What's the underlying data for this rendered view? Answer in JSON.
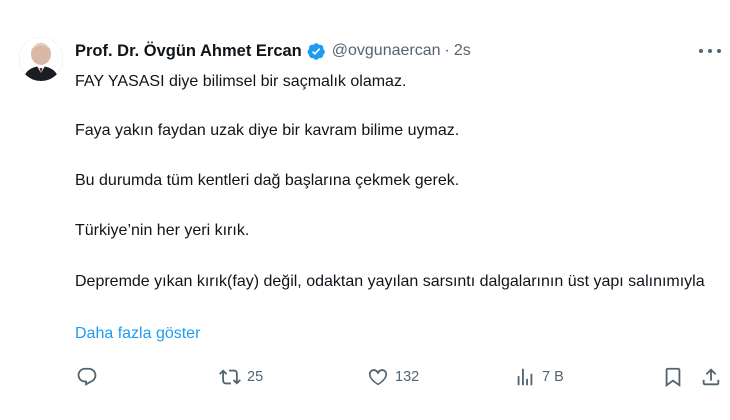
{
  "author": {
    "name": "Prof. Dr. Övgün Ahmet Ercan",
    "handle": "@ovgunaercan",
    "separator": "·",
    "time": "2s",
    "verified": true,
    "verified_color": "#1d9bf0"
  },
  "tweet": {
    "paragraphs": [
      "FAY YASASI diye bilimsel bir saçmalık olamaz.",
      "Faya yakın faydan uzak diye bir kavram bilime uymaz.",
      "Bu durumda tüm kentleri dağ başlarına çekmek gerek.",
      "Türkiye’nin her yeri kırık.",
      "Depremde yıkan kırık(fay) değil, odaktan yayılan sarsıntı dalgalarının üst yapı salınımıyla"
    ],
    "show_more": "Daha fazla göster"
  },
  "actions": {
    "reply": {
      "icon": "reply-icon",
      "count": ""
    },
    "retweet": {
      "icon": "retweet-icon",
      "count": "25"
    },
    "like": {
      "icon": "heart-icon",
      "count": "132"
    },
    "views": {
      "icon": "views-icon",
      "count": "7 B"
    },
    "bookmark": {
      "icon": "bookmark-icon"
    },
    "share": {
      "icon": "share-icon"
    }
  },
  "colors": {
    "text": "#0f1419",
    "secondary": "#536471",
    "link": "#1d9bf0",
    "background": "#ffffff"
  }
}
